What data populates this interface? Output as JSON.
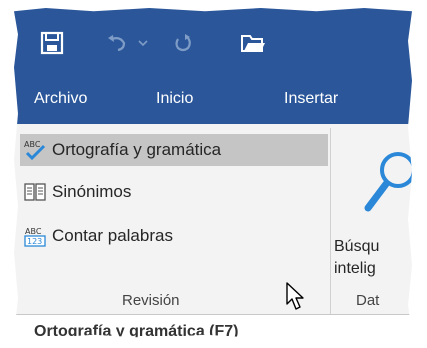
{
  "tabs": {
    "archivo": "Archivo",
    "inicio": "Inicio",
    "insertar": "Insertar"
  },
  "revision": {
    "items": [
      {
        "label": "Ortografía y gramática",
        "icon": "spelling-check-icon",
        "hover": true
      },
      {
        "label": "Sinónimos",
        "icon": "thesaurus-icon",
        "hover": false
      },
      {
        "label": "Contar palabras",
        "icon": "word-count-icon",
        "hover": false
      }
    ],
    "group_label": "Revisión"
  },
  "smart_lookup": {
    "line1": "Búsqu",
    "line2": "intelig"
  },
  "data_group_label": "Dat",
  "tooltip": {
    "title": "Ortografía y gramática (F7)"
  },
  "colors": {
    "ribbon_blue": "#2b579a",
    "ribbon_bg": "#f3f3f3",
    "hover_bg": "#c5c5c5"
  }
}
